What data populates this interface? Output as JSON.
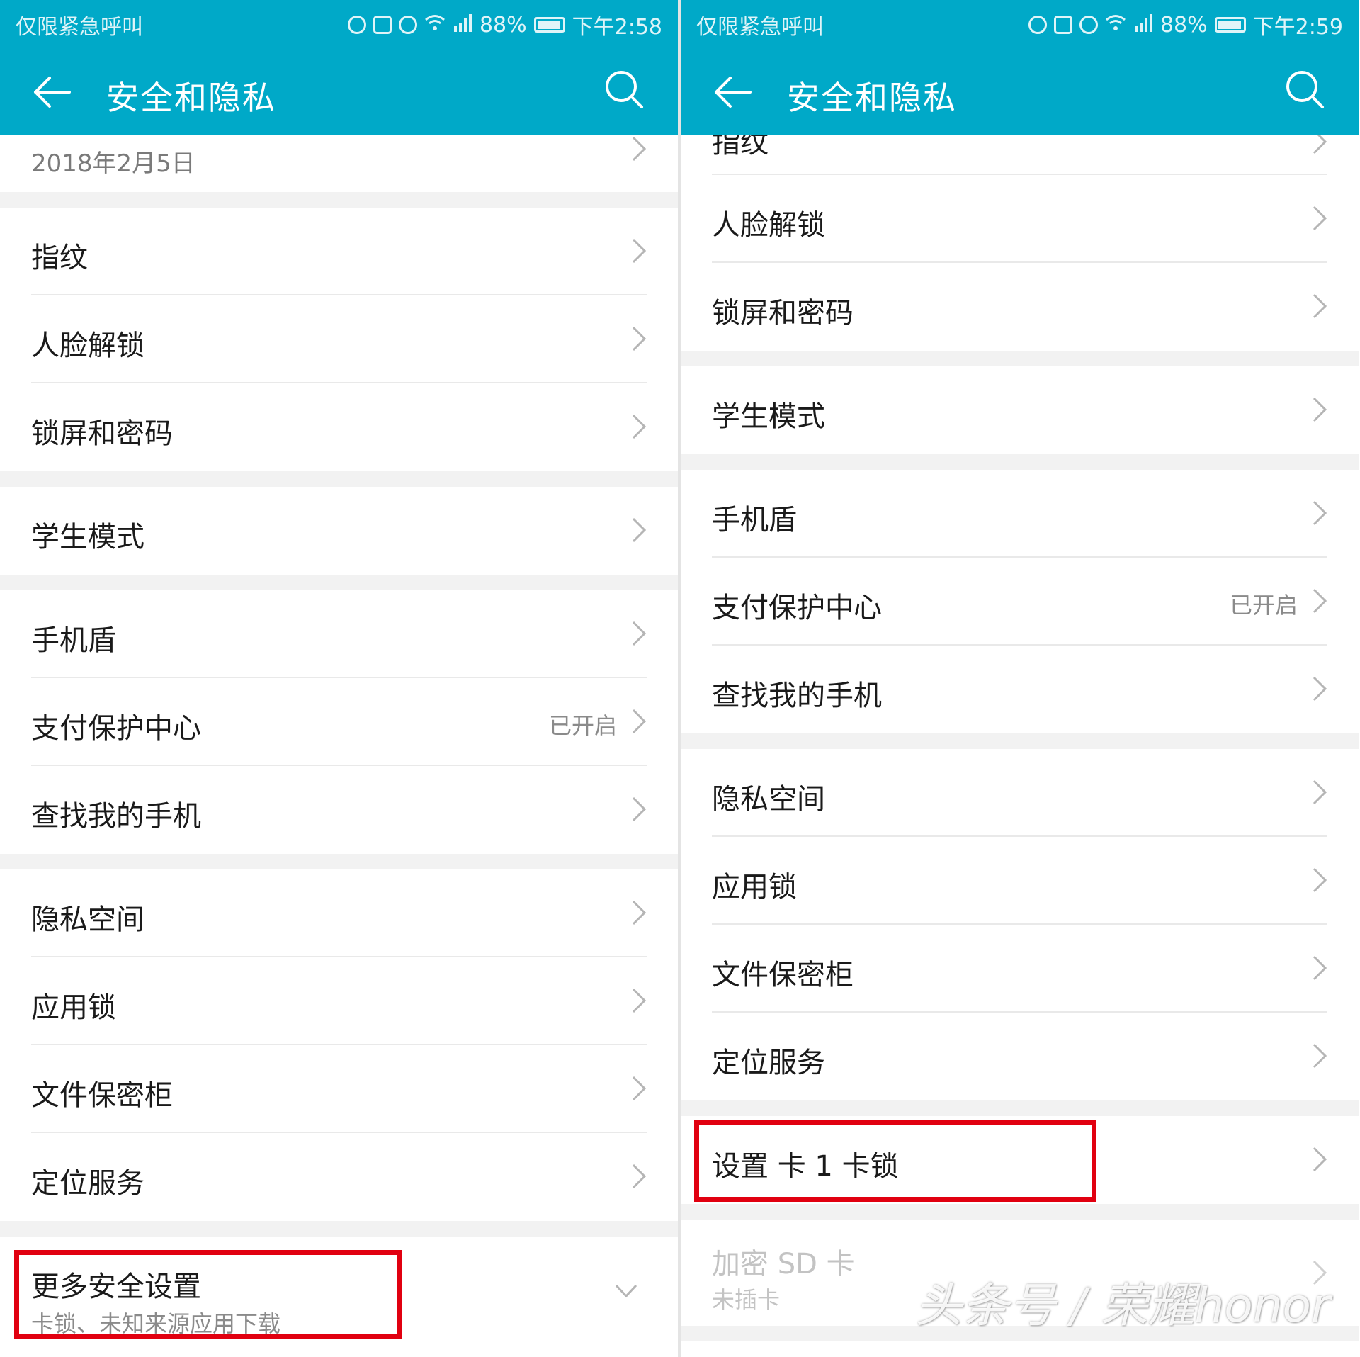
{
  "left": {
    "status": {
      "emergency": "仅限紧急呼叫",
      "battery": "88%",
      "time": "下午2:58"
    },
    "title": "安全和隐私",
    "date_text": "2018年2月5日",
    "items": {
      "fingerprint": "指纹",
      "face_unlock": "人脸解锁",
      "lock_screen": "锁屏和密码",
      "student_mode": "学生模式",
      "phone_shield": "手机盾",
      "payment_center": "支付保护中心",
      "payment_status": "已开启",
      "find_phone": "查找我的手机",
      "private_space": "隐私空间",
      "app_lock": "应用锁",
      "file_safe": "文件保密柜",
      "location": "定位服务",
      "more_settings": "更多安全设置",
      "more_settings_sub": "卡锁、未知来源应用下载"
    }
  },
  "right": {
    "status": {
      "emergency": "仅限紧急呼叫",
      "battery": "88%",
      "time": "下午2:59"
    },
    "title": "安全和隐私",
    "items": {
      "fingerprint": "指纹",
      "face_unlock": "人脸解锁",
      "lock_screen": "锁屏和密码",
      "student_mode": "学生模式",
      "phone_shield": "手机盾",
      "payment_center": "支付保护中心",
      "payment_status": "已开启",
      "find_phone": "查找我的手机",
      "private_space": "隐私空间",
      "app_lock": "应用锁",
      "file_safe": "文件保密柜",
      "location": "定位服务",
      "sim_lock": "设置 卡 1 卡锁",
      "sd_encrypt": "加密 SD 卡",
      "sd_status": "未插卡"
    },
    "watermark": "头条号 / 荣耀honor"
  },
  "colors": {
    "accent": "#00a9c8",
    "highlight": "#e10010",
    "divider": "#e9e9e9",
    "gap": "#f2f2f2"
  }
}
